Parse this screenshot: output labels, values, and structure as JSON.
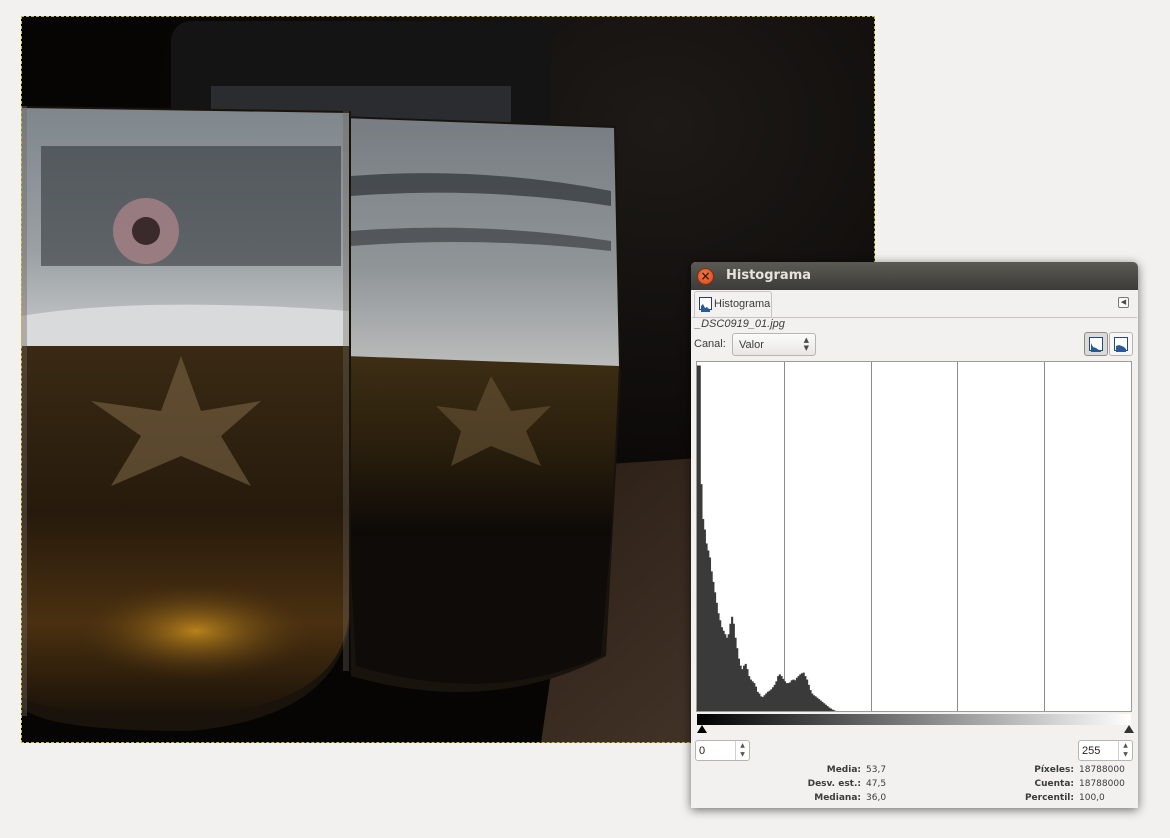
{
  "dialog": {
    "title": "Histograma",
    "tab_label": "Histograma",
    "filename": "_DSC0919_01.jpg",
    "channel_label": "Canal:",
    "channel_value": "Valor",
    "range_min": "0",
    "range_max": "255"
  },
  "stats": {
    "mean_label": "Media:",
    "mean_value": "53,7",
    "stddev_label": "Desv. est.:",
    "stddev_value": "47,5",
    "median_label": "Mediana:",
    "median_value": "36,0",
    "pixels_label": "Píxeles:",
    "pixels_value": "18788000",
    "count_label": "Cuenta:",
    "count_value": "18788000",
    "percentile_label": "Percentil:",
    "percentile_value": "100,0"
  },
  "histogram": {
    "channel": "value",
    "scale": "linear",
    "bar_color": "#3a3a3a",
    "grid_divisions": 5,
    "profile": [
      [
        0,
        0.99
      ],
      [
        1,
        0.99
      ],
      [
        2,
        0.65
      ],
      [
        3,
        0.55
      ],
      [
        4,
        0.52
      ],
      [
        5,
        0.48
      ],
      [
        6,
        0.46
      ],
      [
        7,
        0.44
      ],
      [
        8,
        0.4
      ],
      [
        9,
        0.37
      ],
      [
        10,
        0.34
      ],
      [
        11,
        0.31
      ],
      [
        12,
        0.28
      ],
      [
        13,
        0.26
      ],
      [
        14,
        0.24
      ],
      [
        15,
        0.23
      ],
      [
        16,
        0.22
      ],
      [
        17,
        0.21
      ],
      [
        18,
        0.22
      ],
      [
        19,
        0.25
      ],
      [
        20,
        0.27
      ],
      [
        21,
        0.25
      ],
      [
        22,
        0.21
      ],
      [
        23,
        0.18
      ],
      [
        24,
        0.15
      ],
      [
        25,
        0.13
      ],
      [
        26,
        0.12
      ],
      [
        27,
        0.13
      ],
      [
        28,
        0.135
      ],
      [
        29,
        0.12
      ],
      [
        30,
        0.1
      ],
      [
        31,
        0.09
      ],
      [
        32,
        0.085
      ],
      [
        33,
        0.08
      ],
      [
        34,
        0.07
      ],
      [
        35,
        0.055
      ],
      [
        36,
        0.05
      ],
      [
        37,
        0.042
      ],
      [
        38,
        0.04
      ],
      [
        39,
        0.045
      ],
      [
        40,
        0.05
      ],
      [
        41,
        0.055
      ],
      [
        42,
        0.058
      ],
      [
        43,
        0.062
      ],
      [
        44,
        0.068
      ],
      [
        45,
        0.075
      ],
      [
        46,
        0.085
      ],
      [
        47,
        0.1
      ],
      [
        48,
        0.105
      ],
      [
        49,
        0.1
      ],
      [
        50,
        0.092
      ],
      [
        51,
        0.085
      ],
      [
        52,
        0.08
      ],
      [
        53,
        0.08
      ],
      [
        54,
        0.082
      ],
      [
        55,
        0.088
      ],
      [
        56,
        0.09
      ],
      [
        57,
        0.088
      ],
      [
        58,
        0.095
      ],
      [
        59,
        0.1
      ],
      [
        60,
        0.105
      ],
      [
        61,
        0.108
      ],
      [
        62,
        0.11
      ],
      [
        63,
        0.1
      ],
      [
        64,
        0.09
      ],
      [
        65,
        0.075
      ],
      [
        66,
        0.06
      ],
      [
        67,
        0.05
      ],
      [
        68,
        0.045
      ],
      [
        69,
        0.042
      ],
      [
        70,
        0.038
      ],
      [
        71,
        0.034
      ],
      [
        72,
        0.03
      ],
      [
        73,
        0.026
      ],
      [
        74,
        0.022
      ],
      [
        75,
        0.018
      ],
      [
        76,
        0.014
      ],
      [
        77,
        0.01
      ],
      [
        78,
        0.007
      ],
      [
        79,
        0.004
      ],
      [
        80,
        0.002
      ],
      [
        81,
        0.0
      ]
    ]
  }
}
